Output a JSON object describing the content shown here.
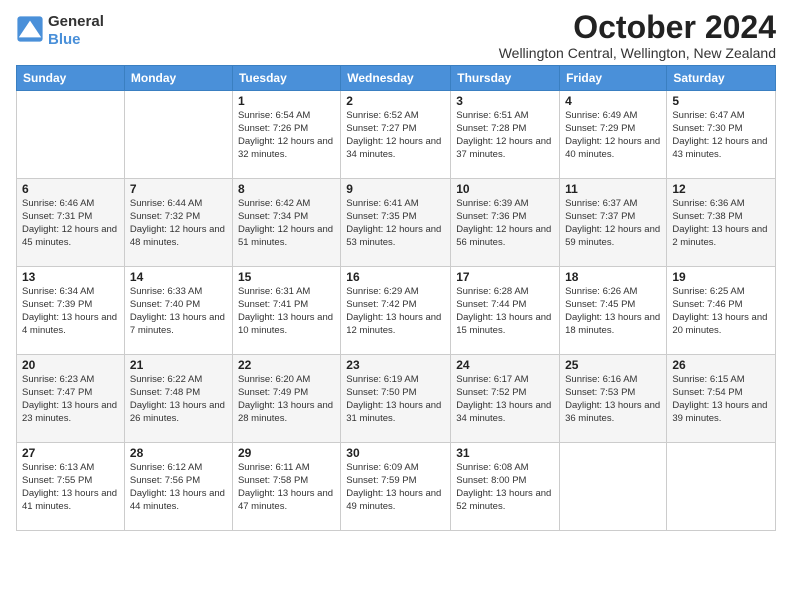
{
  "logo": {
    "general": "General",
    "blue": "Blue"
  },
  "title": "October 2024",
  "location": "Wellington Central, Wellington, New Zealand",
  "weekdays": [
    "Sunday",
    "Monday",
    "Tuesday",
    "Wednesday",
    "Thursday",
    "Friday",
    "Saturday"
  ],
  "weeks": [
    [
      {
        "day": "",
        "info": ""
      },
      {
        "day": "",
        "info": ""
      },
      {
        "day": "1",
        "info": "Sunrise: 6:54 AM\nSunset: 7:26 PM\nDaylight: 12 hours and 32 minutes."
      },
      {
        "day": "2",
        "info": "Sunrise: 6:52 AM\nSunset: 7:27 PM\nDaylight: 12 hours and 34 minutes."
      },
      {
        "day": "3",
        "info": "Sunrise: 6:51 AM\nSunset: 7:28 PM\nDaylight: 12 hours and 37 minutes."
      },
      {
        "day": "4",
        "info": "Sunrise: 6:49 AM\nSunset: 7:29 PM\nDaylight: 12 hours and 40 minutes."
      },
      {
        "day": "5",
        "info": "Sunrise: 6:47 AM\nSunset: 7:30 PM\nDaylight: 12 hours and 43 minutes."
      }
    ],
    [
      {
        "day": "6",
        "info": "Sunrise: 6:46 AM\nSunset: 7:31 PM\nDaylight: 12 hours and 45 minutes."
      },
      {
        "day": "7",
        "info": "Sunrise: 6:44 AM\nSunset: 7:32 PM\nDaylight: 12 hours and 48 minutes."
      },
      {
        "day": "8",
        "info": "Sunrise: 6:42 AM\nSunset: 7:34 PM\nDaylight: 12 hours and 51 minutes."
      },
      {
        "day": "9",
        "info": "Sunrise: 6:41 AM\nSunset: 7:35 PM\nDaylight: 12 hours and 53 minutes."
      },
      {
        "day": "10",
        "info": "Sunrise: 6:39 AM\nSunset: 7:36 PM\nDaylight: 12 hours and 56 minutes."
      },
      {
        "day": "11",
        "info": "Sunrise: 6:37 AM\nSunset: 7:37 PM\nDaylight: 12 hours and 59 minutes."
      },
      {
        "day": "12",
        "info": "Sunrise: 6:36 AM\nSunset: 7:38 PM\nDaylight: 13 hours and 2 minutes."
      }
    ],
    [
      {
        "day": "13",
        "info": "Sunrise: 6:34 AM\nSunset: 7:39 PM\nDaylight: 13 hours and 4 minutes."
      },
      {
        "day": "14",
        "info": "Sunrise: 6:33 AM\nSunset: 7:40 PM\nDaylight: 13 hours and 7 minutes."
      },
      {
        "day": "15",
        "info": "Sunrise: 6:31 AM\nSunset: 7:41 PM\nDaylight: 13 hours and 10 minutes."
      },
      {
        "day": "16",
        "info": "Sunrise: 6:29 AM\nSunset: 7:42 PM\nDaylight: 13 hours and 12 minutes."
      },
      {
        "day": "17",
        "info": "Sunrise: 6:28 AM\nSunset: 7:44 PM\nDaylight: 13 hours and 15 minutes."
      },
      {
        "day": "18",
        "info": "Sunrise: 6:26 AM\nSunset: 7:45 PM\nDaylight: 13 hours and 18 minutes."
      },
      {
        "day": "19",
        "info": "Sunrise: 6:25 AM\nSunset: 7:46 PM\nDaylight: 13 hours and 20 minutes."
      }
    ],
    [
      {
        "day": "20",
        "info": "Sunrise: 6:23 AM\nSunset: 7:47 PM\nDaylight: 13 hours and 23 minutes."
      },
      {
        "day": "21",
        "info": "Sunrise: 6:22 AM\nSunset: 7:48 PM\nDaylight: 13 hours and 26 minutes."
      },
      {
        "day": "22",
        "info": "Sunrise: 6:20 AM\nSunset: 7:49 PM\nDaylight: 13 hours and 28 minutes."
      },
      {
        "day": "23",
        "info": "Sunrise: 6:19 AM\nSunset: 7:50 PM\nDaylight: 13 hours and 31 minutes."
      },
      {
        "day": "24",
        "info": "Sunrise: 6:17 AM\nSunset: 7:52 PM\nDaylight: 13 hours and 34 minutes."
      },
      {
        "day": "25",
        "info": "Sunrise: 6:16 AM\nSunset: 7:53 PM\nDaylight: 13 hours and 36 minutes."
      },
      {
        "day": "26",
        "info": "Sunrise: 6:15 AM\nSunset: 7:54 PM\nDaylight: 13 hours and 39 minutes."
      }
    ],
    [
      {
        "day": "27",
        "info": "Sunrise: 6:13 AM\nSunset: 7:55 PM\nDaylight: 13 hours and 41 minutes."
      },
      {
        "day": "28",
        "info": "Sunrise: 6:12 AM\nSunset: 7:56 PM\nDaylight: 13 hours and 44 minutes."
      },
      {
        "day": "29",
        "info": "Sunrise: 6:11 AM\nSunset: 7:58 PM\nDaylight: 13 hours and 47 minutes."
      },
      {
        "day": "30",
        "info": "Sunrise: 6:09 AM\nSunset: 7:59 PM\nDaylight: 13 hours and 49 minutes."
      },
      {
        "day": "31",
        "info": "Sunrise: 6:08 AM\nSunset: 8:00 PM\nDaylight: 13 hours and 52 minutes."
      },
      {
        "day": "",
        "info": ""
      },
      {
        "day": "",
        "info": ""
      }
    ]
  ]
}
